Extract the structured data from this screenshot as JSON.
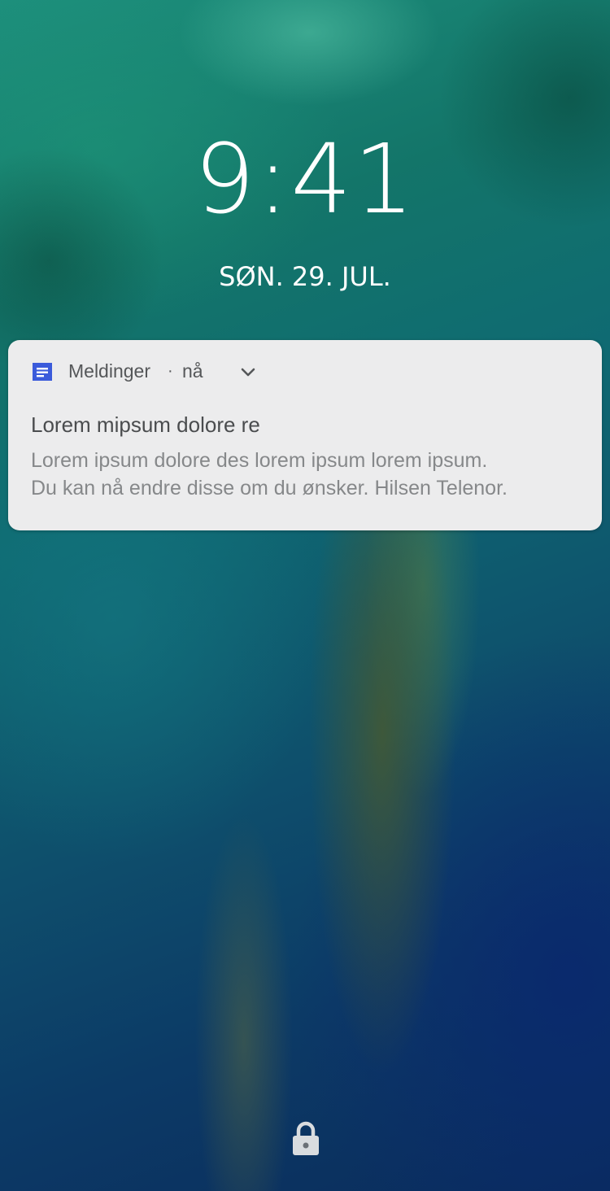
{
  "lockscreen": {
    "time": "9:41",
    "date": "SØN. 29. JUL."
  },
  "notification": {
    "app_icon": "messages-icon",
    "app_name": "Meldinger",
    "separator": "·",
    "time_ago": "nå",
    "expand_icon": "chevron-down-icon",
    "title": "Lorem mipsum dolore re",
    "body_lines": [
      "Lorem ipsum dolore des lorem ipsum lorem ipsum.",
      "Du kan nå endre disse om du ønsker. Hilsen Telenor."
    ],
    "accent_color": "#3b5bdb"
  },
  "lock_icon": "lock-icon"
}
